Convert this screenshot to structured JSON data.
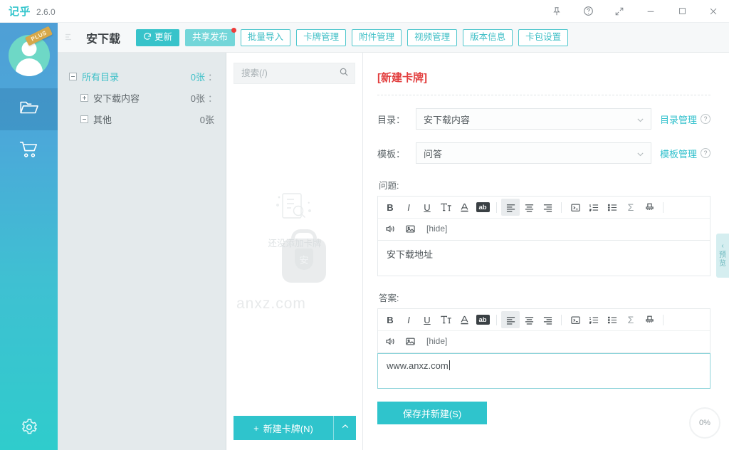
{
  "titlebar": {
    "brand": "记乎",
    "version": "2.6.0",
    "icons": {
      "pin": "pin-icon",
      "help": "help-icon",
      "expand": "expand-icon",
      "minimize": "minimize-icon",
      "maximize": "maximize-icon",
      "close": "close-icon"
    }
  },
  "rail": {
    "avatar_badge": "PLUS",
    "items": [
      {
        "name": "avatar",
        "label": ""
      },
      {
        "name": "decks",
        "label": ""
      },
      {
        "name": "store",
        "label": ""
      }
    ],
    "settings": "settings"
  },
  "header": {
    "deck_title": "安下载",
    "toolbar": [
      {
        "label": "更新",
        "style": "solid",
        "icon": "refresh-icon",
        "badge": false
      },
      {
        "label": "共享发布",
        "style": "solid-light",
        "icon": "",
        "badge": true
      },
      {
        "label": "批量导入",
        "style": "outline",
        "icon": "",
        "badge": false
      },
      {
        "label": "卡牌管理",
        "style": "outline",
        "icon": "",
        "badge": false
      },
      {
        "label": "附件管理",
        "style": "outline",
        "icon": "",
        "badge": false
      },
      {
        "label": "视频管理",
        "style": "outline",
        "icon": "",
        "badge": false
      },
      {
        "label": "版本信息",
        "style": "outline",
        "icon": "",
        "badge": false
      },
      {
        "label": "卡包设置",
        "style": "outline",
        "icon": "",
        "badge": false
      }
    ]
  },
  "tree": {
    "rows": [
      {
        "label": "所有目录",
        "count": "0张",
        "colon": "：",
        "level": 1,
        "toggle": "minus",
        "selected": true
      },
      {
        "label": "安下载内容",
        "count": "0张",
        "colon": "：",
        "level": 2,
        "toggle": "plus",
        "selected": false
      },
      {
        "label": "其他",
        "count": "0张",
        "colon": "",
        "level": 2,
        "toggle": "minus",
        "selected": false
      }
    ]
  },
  "list_panel": {
    "search": {
      "value": "",
      "placeholder": "搜索(/)",
      "icon": "search-icon"
    },
    "empty_text": "还没添加卡牌",
    "watermark_text": "anxz.com",
    "watermark_mark": "安",
    "new_card_button": "新建卡牌(N)",
    "new_card_plus": "+",
    "new_card_caret": "⌃"
  },
  "editor": {
    "title": "[新建卡牌]",
    "fields": [
      {
        "label": "目录：",
        "value": "安下载内容",
        "link": "目录管理",
        "help": "?"
      },
      {
        "label": "模板：",
        "value": "问答",
        "link": "模板管理",
        "help": "?"
      }
    ],
    "question": {
      "section_label": "问题:",
      "value": "安下载地址",
      "focused": false
    },
    "answer": {
      "section_label": "答案:",
      "value": "www.anxz.com",
      "focused": true
    },
    "rte_buttons": [
      {
        "name": "bold",
        "glyph": "B",
        "style": "bold",
        "active": false
      },
      {
        "name": "italic",
        "glyph": "I",
        "style": "italic",
        "active": false
      },
      {
        "name": "underline",
        "glyph": "U",
        "style": "underline",
        "active": false
      },
      {
        "name": "clear-format",
        "glyph": "T",
        "style": "tt",
        "active": false
      },
      {
        "name": "font-color",
        "glyph": "A",
        "style": "color",
        "active": false
      },
      {
        "name": "highlight",
        "glyph": "ab",
        "style": "inverse",
        "active": false
      },
      {
        "name": "align-left",
        "glyph": "",
        "style": "icon",
        "active": true
      },
      {
        "name": "align-center",
        "glyph": "",
        "style": "icon",
        "active": false
      },
      {
        "name": "align-right",
        "glyph": "",
        "style": "icon",
        "active": false
      },
      {
        "name": "code-block",
        "glyph": "",
        "style": "icon",
        "active": false
      },
      {
        "name": "ordered-list",
        "glyph": "",
        "style": "icon",
        "active": false
      },
      {
        "name": "bullet-list",
        "glyph": "",
        "style": "icon",
        "active": false
      },
      {
        "name": "formula",
        "glyph": "Σ",
        "style": "sigma",
        "active": false
      },
      {
        "name": "eraser",
        "glyph": "",
        "style": "icon",
        "active": false
      }
    ],
    "rte_row2": {
      "audio": "audio-icon",
      "image": "image-icon",
      "hide": "[hide]"
    },
    "save_button": "保存并新建(S)"
  },
  "preview_tab": {
    "char1": "预",
    "char2": "览",
    "chevron": "‹"
  },
  "progress": {
    "value": "0%"
  },
  "colors": {
    "accent_teal": "#2fc4cc",
    "accent_teal_light": "#73d6d9",
    "title_red": "#e23d3d",
    "rail_top": "#4f9fd6",
    "rail_bottom": "#2fcccc",
    "panel_bg": "#e4eaec",
    "badge_red": "#ef3b39",
    "plus_gold": "#d7a84a"
  }
}
